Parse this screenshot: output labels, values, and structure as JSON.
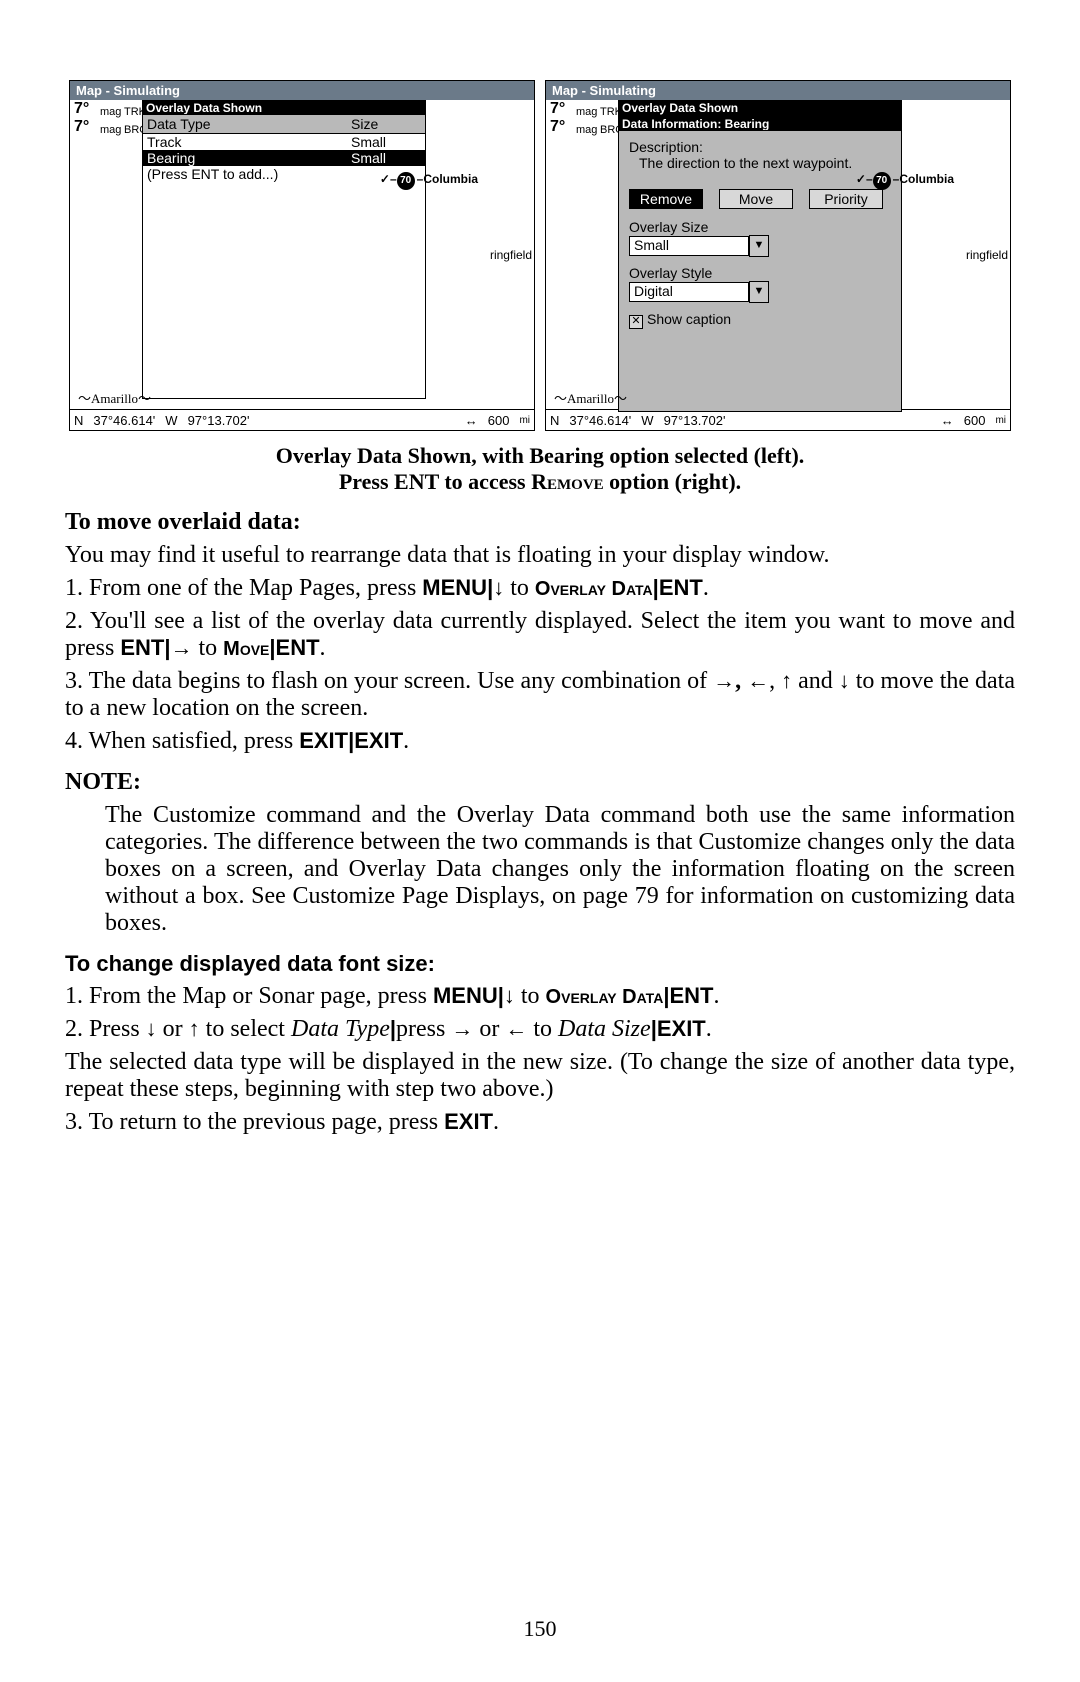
{
  "shots": {
    "titlebar": "Map - Simulating",
    "trk_val": "7°",
    "trk_unit": "mag",
    "trk_lbl": "TRK",
    "brg_val": "7°",
    "brg_unit": "mag",
    "brg_lbl": "BRG",
    "overlay_title": "Overlay Data Shown",
    "list_hdr_col1": "Data Type",
    "list_hdr_col2": "Size",
    "list_rows": [
      {
        "c1": "Track",
        "c2": "Small",
        "sel": false
      },
      {
        "c1": "Bearing",
        "c2": "Small",
        "sel": true
      },
      {
        "c1": "(Press ENT to add...)",
        "c2": "",
        "sel": false
      }
    ],
    "info_title": "Data Information: Bearing",
    "desc_label": "Description:",
    "desc_text": "The direction to the next waypoint.",
    "btn_remove": "Remove",
    "btn_move": "Move",
    "btn_priority": "Priority",
    "ov_size_lbl": "Overlay Size",
    "ov_size_val": "Small",
    "ov_style_lbl": "Overlay Style",
    "ov_style_val": "Digital",
    "show_caption": "Show caption",
    "hwy_num": "70",
    "hwy_city": "Columbia",
    "ringfield": "ringfield",
    "amarillo": "Amarillo",
    "status_n": "N",
    "status_lat": "37°46.614'",
    "status_w": "W",
    "status_lon": "97°13.702'",
    "status_scale": "600",
    "status_unit": "mi"
  },
  "caption_line1": "Overlay Data Shown, with Bearing option selected (left).",
  "caption_line2a": "Press ",
  "caption_ent": "ENT",
  "caption_line2b": " to access ",
  "caption_remove": "Remove",
  "caption_line2c": " option (right).",
  "h_move": "To move overlaid data:",
  "p_move_intro": "You may find it useful to rearrange data that is floating in your display window.",
  "s1a": "1. From one of the Map Pages, press ",
  "menu": "MENU",
  "pipe": "|",
  "down": "↓",
  "to": " to ",
  "ovdata": "Overlay Data",
  "ent": "ENT",
  "period": ".",
  "s2a": "2. You'll see a list of the overlay data currently displayed. Select the item you want to move and press ",
  "right": "→",
  "move": "Move",
  "s3a": "3. The data begins to flash on your screen. Use any combination of ",
  "comma": ",",
  "left": "←",
  "up": "↑",
  "and": " and ",
  "s3b": " to move the data to a new location on the screen.",
  "s4a": "4. When satisfied, press ",
  "exit": "EXIT",
  "note_head": "NOTE:",
  "note_body": "The Customize command and the Overlay Data command both use the same information categories. The difference between the two commands is that Customize changes only the data boxes on a screen, and Overlay Data changes only the information floating on the screen without a box. See Customize Page Displays, on page 79 for information on customizing data boxes.",
  "h_font": "To change displayed data font size:",
  "f1a": "1. From the Map or Sonar page, press ",
  "f2a": "2. Press ",
  "or": " or ",
  "f2b": " to select ",
  "datatype": "Data Type",
  "f2c": "press ",
  "datasize": "Data Size",
  "f_post": "The selected data type will be displayed in the new size. (To change the size of another data type, repeat these steps, beginning with step two above.)",
  "f3a": "3. To return to the previous page, press ",
  "page_number": "150"
}
